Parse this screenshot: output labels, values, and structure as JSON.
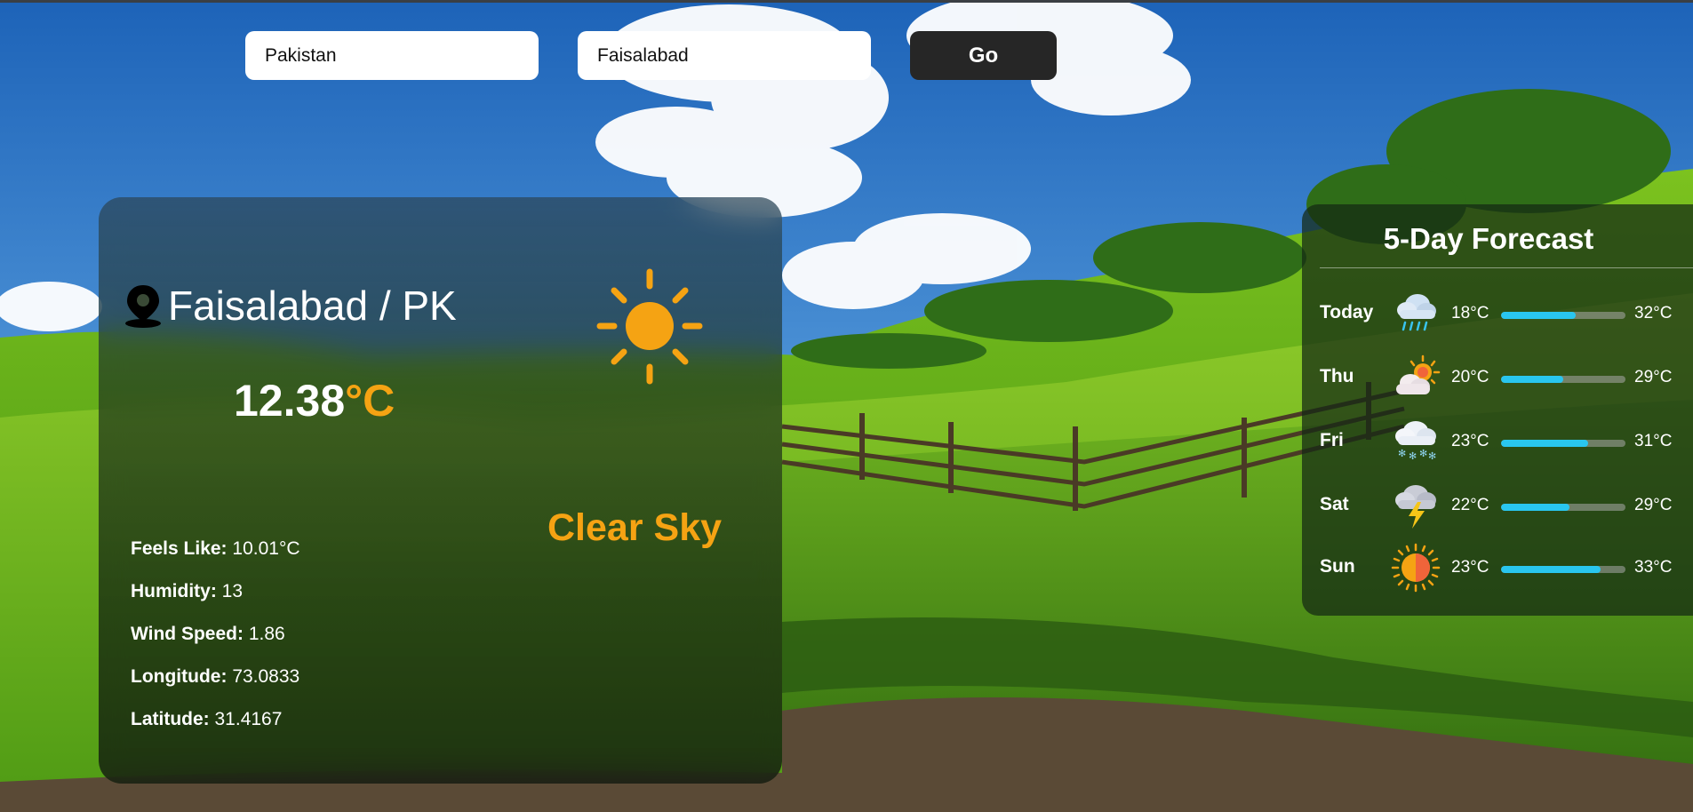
{
  "search": {
    "country_value": "Pakistan",
    "city_value": "Faisalabad",
    "go_label": "Go"
  },
  "current": {
    "location": "Faisalabad / PK",
    "temp_value": "12.38",
    "temp_unit": "°C",
    "condition": "Clear Sky",
    "icon": "sun-icon",
    "details": [
      {
        "label": "Feels Like:",
        "value": "10.01°C"
      },
      {
        "label": "Humidity:",
        "value": "13"
      },
      {
        "label": "Wind Speed:",
        "value": "1.86"
      },
      {
        "label": "Longitude:",
        "value": "73.0833"
      },
      {
        "label": "Latitude:",
        "value": "31.4167"
      }
    ]
  },
  "forecast": {
    "title": "5-Day Forecast",
    "days": [
      {
        "day": "Today",
        "low": "18°C",
        "high": "32°C",
        "icon": "rain-cloud-icon",
        "level": 0.6
      },
      {
        "day": "Thu",
        "low": "20°C",
        "high": "29°C",
        "icon": "sun-behind-cloud-icon",
        "level": 0.5
      },
      {
        "day": "Fri",
        "low": "23°C",
        "high": "31°C",
        "icon": "snow-cloud-icon",
        "level": 0.7
      },
      {
        "day": "Sat",
        "low": "22°C",
        "high": "29°C",
        "icon": "thunder-cloud-icon",
        "level": 0.55
      },
      {
        "day": "Sun",
        "low": "23°C",
        "high": "33°C",
        "icon": "sun-icon",
        "level": 0.8
      }
    ]
  },
  "colors": {
    "accent": "#f5a313",
    "bar_fill": "#29c6ef",
    "button_bg": "#262626"
  }
}
